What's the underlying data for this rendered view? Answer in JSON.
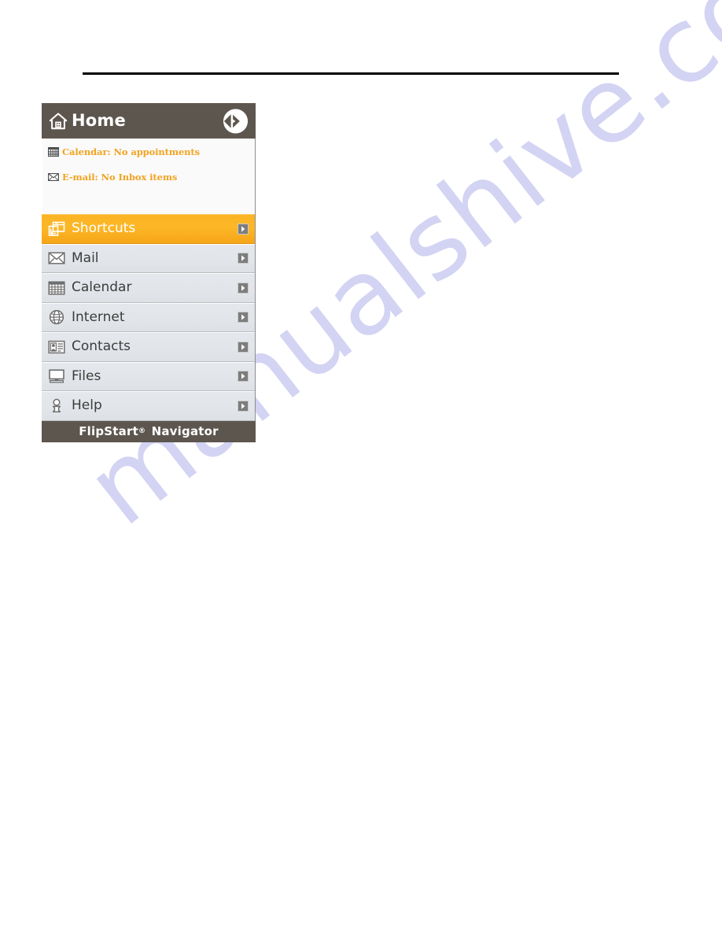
{
  "page": {
    "background_color": "#ffffff",
    "rule_color": "#000000"
  },
  "watermark": {
    "text": "manualshive.com",
    "color": "#ccccf2"
  },
  "navigator": {
    "header": {
      "title": "Home",
      "home_icon": "home-icon",
      "expand_icon": "expand-chevron-circle-icon",
      "background_color": "#5d564e"
    },
    "status": {
      "items": [
        {
          "icon": "calendar-icon",
          "text": "Calendar: No appointments"
        },
        {
          "icon": "envelope-icon",
          "text": "E-mail: No Inbox items"
        }
      ],
      "text_color": "#f2a321"
    },
    "shortcuts": {
      "accent_color": "#fbb424",
      "row_color": "#e2e6ea",
      "items": [
        {
          "label": "Shortcuts",
          "icon": "shortcuts-window-icon",
          "arrow": "chevron-right-icon",
          "selected": true
        },
        {
          "label": "Mail",
          "icon": "envelope-icon",
          "arrow": "chevron-right-icon",
          "selected": false
        },
        {
          "label": "Calendar",
          "icon": "calendar-grid-icon",
          "arrow": "chevron-right-icon",
          "selected": false
        },
        {
          "label": "Internet",
          "icon": "globe-icon",
          "arrow": "chevron-right-icon",
          "selected": false
        },
        {
          "label": "Contacts",
          "icon": "contact-card-icon",
          "arrow": "chevron-right-icon",
          "selected": false
        },
        {
          "label": "Files",
          "icon": "computer-monitor-icon",
          "arrow": "chevron-right-icon",
          "selected": false
        },
        {
          "label": "Help",
          "icon": "help-person-icon",
          "arrow": "chevron-right-icon",
          "selected": false
        }
      ]
    },
    "footer": {
      "brand": "FlipStart",
      "registered_mark": "®",
      "product": "Navigator",
      "background_color": "#5d564e"
    }
  }
}
